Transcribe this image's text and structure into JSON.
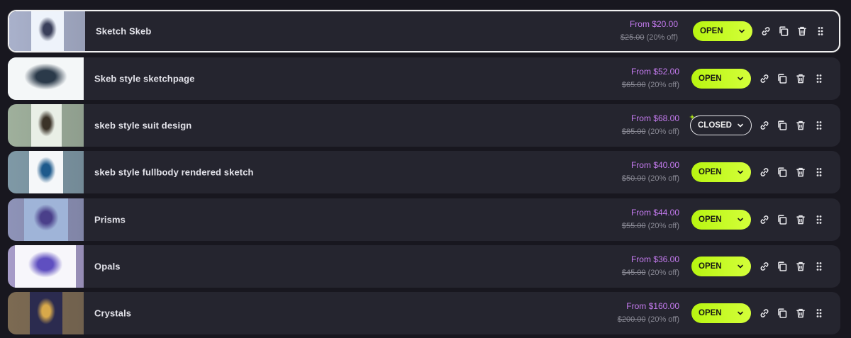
{
  "rows": [
    {
      "title": "Sketch Skeb",
      "price": "From $20.00",
      "original": "$25.00",
      "discount": "(20% off)",
      "status": "OPEN",
      "thumb_bg": "#a9b1cb",
      "art_bg": "#eef3fb",
      "art_accent": "#3a3f5a"
    },
    {
      "title": "Skeb style sketchpage",
      "price": "From $52.00",
      "original": "$65.00",
      "discount": "(20% off)",
      "status": "OPEN",
      "thumb_bg": "#dfe6ea",
      "art_bg": "#f4f7f8",
      "art_accent": "#2b3a4a"
    },
    {
      "title": "skeb style suit design",
      "price": "From $68.00",
      "original": "$85.00",
      "discount": "(20% off)",
      "status": "CLOSED",
      "thumb_bg": "#9fb09c",
      "art_bg": "#e9efe6",
      "art_accent": "#3b3328"
    },
    {
      "title": "skeb style fullbody rendered sketch",
      "price": "From $40.00",
      "original": "$50.00",
      "discount": "(20% off)",
      "status": "OPEN",
      "thumb_bg": "#7f99a6",
      "art_bg": "#f5f7f9",
      "art_accent": "#1e5a8c"
    },
    {
      "title": "Prisms",
      "price": "From $44.00",
      "original": "$55.00",
      "discount": "(20% off)",
      "status": "OPEN",
      "thumb_bg": "#8e93b8",
      "art_bg": "#9fb4d8",
      "art_accent": "#4a3f8a"
    },
    {
      "title": "Opals",
      "price": "From $36.00",
      "original": "$45.00",
      "discount": "(20% off)",
      "status": "OPEN",
      "thumb_bg": "#a79cc9",
      "art_bg": "#f7f6fb",
      "art_accent": "#5f4fc0"
    },
    {
      "title": "Crystals",
      "price": "From $160.00",
      "original": "$200.00",
      "discount": "(20% off)",
      "status": "OPEN",
      "thumb_bg": "#7c6a52",
      "art_bg": "#2b2b4f",
      "art_accent": "#d8a94a"
    }
  ],
  "colors": {
    "open_bg": "#c4fb24",
    "price": "#c57bf0",
    "row_bg": "#25252f",
    "page_bg": "#18171f"
  },
  "icons": [
    "link-icon",
    "copy-icon",
    "trash-icon",
    "drag-handle-icon",
    "chevron-down-icon"
  ]
}
